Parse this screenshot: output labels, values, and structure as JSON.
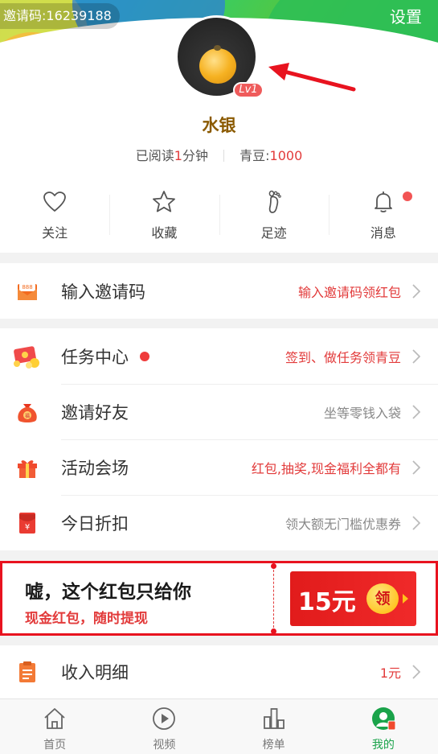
{
  "header": {
    "invite_code_label": "邀请码:16239188",
    "settings_label": "设置",
    "level_badge": "Lv1"
  },
  "profile": {
    "username": "水银",
    "read_prefix": "已阅读",
    "read_value": "1",
    "read_suffix": "分钟",
    "beans_label": "青豆:",
    "beans_value": "1000"
  },
  "quick_actions": [
    {
      "label": "关注",
      "icon": "heart-icon"
    },
    {
      "label": "收藏",
      "icon": "star-icon"
    },
    {
      "label": "足迹",
      "icon": "footprint-icon"
    },
    {
      "label": "消息",
      "icon": "bell-icon",
      "has_dot": true
    }
  ],
  "menu": {
    "invite_code": {
      "title": "输入邀请码",
      "hint": "输入邀请码领红包",
      "icon": "envelope-888-icon"
    },
    "task_center": {
      "title": "任务中心",
      "hint": "签到、做任务领青豆",
      "icon": "red-packet-icon"
    },
    "invite_friends": {
      "title": "邀请好友",
      "hint": "坐等零钱入袋",
      "icon": "money-bag-icon"
    },
    "activity": {
      "title": "活动会场",
      "hint": "红包,抽奖,现金福利全都有",
      "icon": "gift-icon"
    },
    "discount": {
      "title": "今日折扣",
      "hint": "领大额无门槛优惠券",
      "icon": "yuan-coupon-icon"
    },
    "income": {
      "title": "收入明细",
      "hint": "1元",
      "icon": "clipboard-icon"
    }
  },
  "banner": {
    "title": "嘘，这个红包只给你",
    "subtitle": "现金红包，随时提现",
    "amount": "15元",
    "claim_label": "领"
  },
  "tabs": [
    {
      "label": "首页",
      "icon": "home-icon"
    },
    {
      "label": "视频",
      "icon": "play-icon"
    },
    {
      "label": "榜单",
      "icon": "chart-icon"
    },
    {
      "label": "我的",
      "icon": "profile-icon",
      "active": true
    }
  ],
  "colors": {
    "accent_red": "#e23b3b",
    "active_green": "#1aa34a",
    "username_brown": "#8b5a00"
  }
}
